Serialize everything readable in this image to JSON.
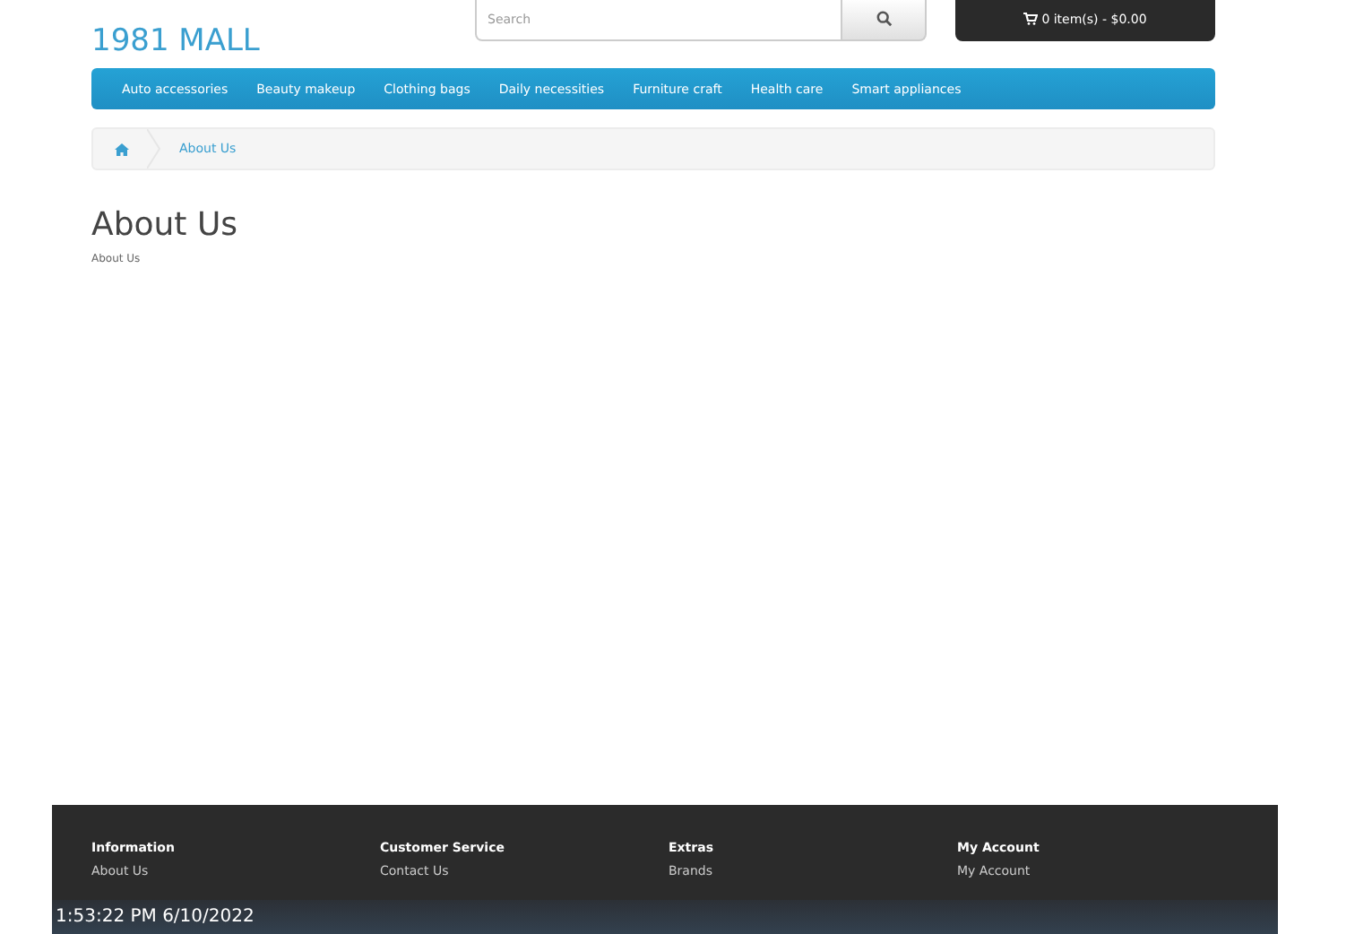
{
  "header": {
    "logo": "1981 MALL",
    "search": {
      "placeholder": "Search"
    },
    "cart": "0 item(s) - $0.00"
  },
  "menu": [
    "Auto accessories",
    "Beauty makeup",
    "Clothing bags",
    "Daily necessities",
    "Furniture craft",
    "Health care",
    "Smart appliances"
  ],
  "breadcrumb": [
    "About Us"
  ],
  "page": {
    "title": "About Us",
    "text": "About Us"
  },
  "footer": {
    "columns": [
      {
        "heading": "Information",
        "links": [
          "About Us"
        ]
      },
      {
        "heading": "Customer Service",
        "links": [
          "Contact Us"
        ]
      },
      {
        "heading": "Extras",
        "links": [
          "Brands"
        ]
      },
      {
        "heading": "My Account",
        "links": [
          "My Account"
        ]
      }
    ]
  },
  "timestamp": "1:53:22 PM 6/10/2022"
}
